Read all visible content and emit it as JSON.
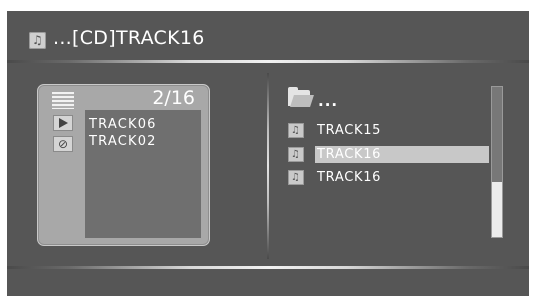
{
  "header": {
    "title": "...[CD]TRACK16",
    "icon": "music-note-icon"
  },
  "playlist": {
    "page_indicator": "2/16",
    "icons": [
      "list-icon",
      "play-icon",
      "trash-icon"
    ],
    "tracks": [
      "TRACK06",
      "TRACK02"
    ]
  },
  "browser": {
    "folder_label": "...",
    "folder_icon": "folder-icon",
    "files": [
      {
        "name": "TRACK15",
        "selected": false
      },
      {
        "name": "TRACK16",
        "selected": true
      },
      {
        "name": "TRACK16",
        "selected": false
      }
    ],
    "scroll_position": 0.0
  },
  "colors": {
    "background": "#565656",
    "selection": "#c8c8c8",
    "panel": "#a8a8a8",
    "list_area": "#6f6f6f"
  }
}
